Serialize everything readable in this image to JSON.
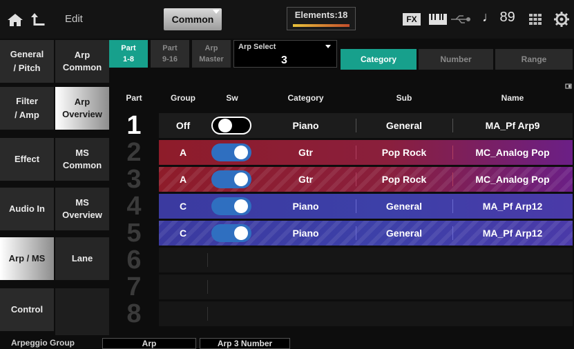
{
  "topbar": {
    "edit_label": "Edit",
    "common_label": "Common",
    "elements_label": "Elements:18",
    "fx_label": "FX",
    "tempo_value": "♩ 89"
  },
  "left_menu": [
    {
      "label": "General\n/ Pitch"
    },
    {
      "label": "Filter\n/ Amp"
    },
    {
      "label": "Effect"
    },
    {
      "label": "Audio In"
    },
    {
      "label": "Arp / MS",
      "active": true
    },
    {
      "label": "Control"
    }
  ],
  "sub_menu": [
    {
      "label": "Arp\nCommon"
    },
    {
      "label": "Arp\nOverview",
      "active": true
    },
    {
      "label": "MS\nCommon"
    },
    {
      "label": "MS\nOverview"
    },
    {
      "label": "Lane"
    }
  ],
  "header": {
    "tab_part1_8": "Part\n1-8",
    "tab_part9_16": "Part\n9-16",
    "tab_arp_master": "Arp\nMaster",
    "arp_select_label": "Arp Select",
    "arp_select_value": "3",
    "seg_category": "Category",
    "seg_number": "Number",
    "seg_range": "Range"
  },
  "table": {
    "headers": {
      "part": "Part",
      "group": "Group",
      "sw": "Sw",
      "category": "Category",
      "sub": "Sub",
      "name": "Name"
    },
    "rows": [
      {
        "part": "1",
        "group": "Off",
        "sw": "off",
        "category": "Piano",
        "sub": "General",
        "name": "MA_Pf Arp9",
        "color": "none"
      },
      {
        "part": "2",
        "group": "A",
        "sw": "on",
        "category": "Gtr",
        "sub": "Pop Rock",
        "name": "MC_Analog Pop",
        "color": "red"
      },
      {
        "part": "3",
        "group": "A",
        "sw": "on",
        "category": "Gtr",
        "sub": "Pop Rock",
        "name": "MC_Analog Pop",
        "color": "red"
      },
      {
        "part": "4",
        "group": "C",
        "sw": "on",
        "category": "Piano",
        "sub": "General",
        "name": "MA_Pf Arp12",
        "color": "blue"
      },
      {
        "part": "5",
        "group": "C",
        "sw": "on",
        "category": "Piano",
        "sub": "General",
        "name": "MA_Pf Arp12",
        "color": "blue"
      },
      {
        "part": "6"
      },
      {
        "part": "7"
      },
      {
        "part": "8"
      }
    ]
  },
  "bottom": {
    "arpeggio_group_label": "Arpeggio Group",
    "arp_label": "Arp",
    "arp3_number_label": "Arp 3 Number"
  },
  "colors": {
    "teal_accent": "#17a08c",
    "red_row": "#8f1e2c",
    "purple_row": "#6f1f8a",
    "blue_row": "#3c3fa6",
    "toggle_on": "#2f6fc0"
  }
}
